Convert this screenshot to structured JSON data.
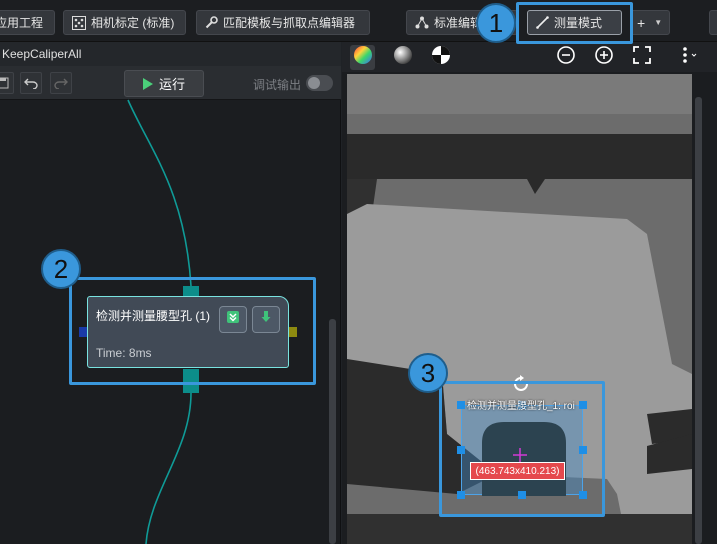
{
  "toolbar": {
    "app_project": "应用工程",
    "camera_calib": "相机标定 (标准)",
    "template_editor": "匹配模板与抓取点编辑器",
    "std_edit": "标准编辑",
    "measure_mode": "测量模式",
    "plus": "+"
  },
  "left_panel": {
    "title": "KeepCaliperAll",
    "run_label": "运行",
    "debug_label": "调试输出"
  },
  "node": {
    "title": "检测并测量腰型孔 (1)",
    "time": "Time: 8ms"
  },
  "viewer": {
    "roi_label": "检测并测量腰型孔_1: roi",
    "coord": "(463.743x410.213)"
  },
  "annotations": {
    "one": "1",
    "two": "2",
    "three": "3"
  },
  "colors": {
    "highlight": "#3a97dc",
    "node_border": "#79e3e0",
    "port": "#0c8d8a",
    "coord_bg": "#e5484d"
  }
}
